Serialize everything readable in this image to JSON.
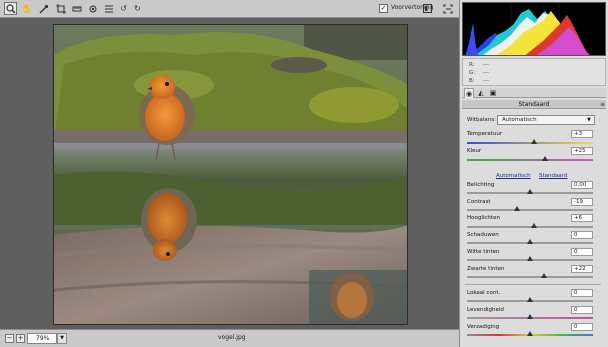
{
  "toolbar": {
    "tools": [
      "zoom-icon",
      "hand-icon",
      "eyedropper-icon",
      "crop-icon",
      "straighten-icon",
      "redeye-icon",
      "list-icon",
      "rotate-left-icon",
      "rotate-right-icon"
    ],
    "preview_label": "Voorvertoning",
    "preview_checked": true
  },
  "status": {
    "zoom": "79%",
    "filename": "vogel.jpg"
  },
  "readout": {
    "r_label": "R:",
    "r_value": "---",
    "g_label": "G:",
    "g_value": "---",
    "b_label": "B:",
    "b_value": "---"
  },
  "panel": {
    "title": "Standaard",
    "wb_label": "Witbalans:",
    "wb_value": "Automatisch",
    "auto_link": "Automatisch",
    "default_link": "Standaard",
    "sliders": [
      {
        "label": "Temperatuur",
        "value": "+3",
        "level": 0.53
      },
      {
        "label": "Kleur",
        "value": "+25",
        "level": 0.62
      },
      {
        "label": "Belichting",
        "value": "0,00",
        "level": 0.5
      },
      {
        "label": "Contrast",
        "value": "-19",
        "level": 0.4
      },
      {
        "label": "Hooglichten",
        "value": "+6",
        "level": 0.53
      },
      {
        "label": "Schaduwen",
        "value": "0",
        "level": 0.5
      },
      {
        "label": "Witte tinten",
        "value": "0",
        "level": 0.5
      },
      {
        "label": "Zwarte tinten",
        "value": "+22",
        "level": 0.61
      },
      {
        "label": "Lokaal cont.",
        "value": "0",
        "level": 0.5
      },
      {
        "label": "Levendigheid",
        "value": "0",
        "level": 0.5
      },
      {
        "label": "Verzadiging",
        "value": "0",
        "level": 0.5
      }
    ]
  },
  "colors": {
    "panel_bg": "#dcdcdc",
    "toolbar_bg": "#c9c9c9",
    "canvas_bg": "#5f5f5f",
    "link": "#1a2f9a"
  }
}
